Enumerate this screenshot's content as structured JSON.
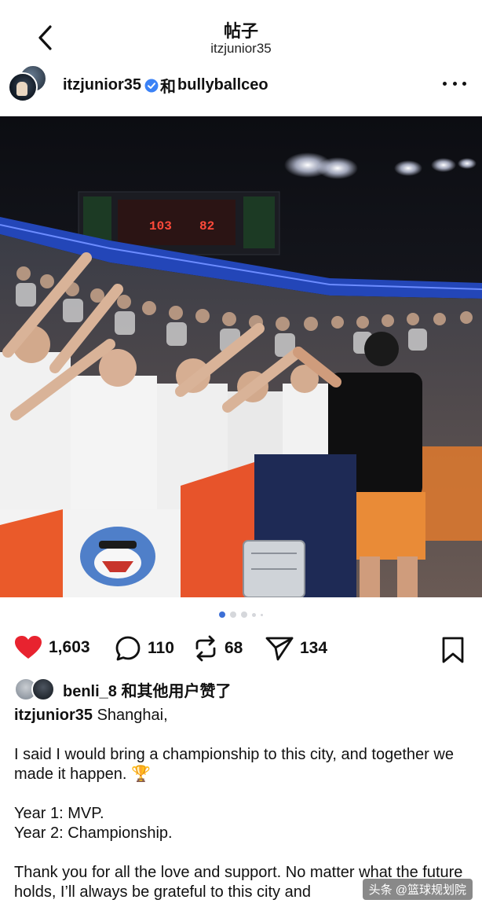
{
  "header": {
    "title": "帖子",
    "subtitle": "itzjunior35"
  },
  "author": {
    "username": "itzjunior35",
    "joiner": "和",
    "collaborator": "bullyballceo"
  },
  "photo": {
    "scoreboard_home": "103",
    "scoreboard_away": "82",
    "pagination": {
      "total": 5,
      "active_index": 0
    }
  },
  "actions": {
    "likes": "1,603",
    "comments": "110",
    "reposts": "68",
    "shares": "134"
  },
  "liked_by": {
    "text": "benli_8 和其他用户赞了"
  },
  "caption": {
    "username": "itzjunior35",
    "first_line": " Shanghai,",
    "paragraph_1": "I said I would bring a championship to this city, and together we made it happen. 🏆",
    "line_year1": "Year 1: MVP.",
    "line_year2": "Year 2: Championship.",
    "paragraph_3": "Thank you for all the love and support. No matter what the future holds, I’ll always be grateful to this city and"
  },
  "watermark": "头条 @篮球规划院",
  "colors": {
    "like_red": "#e8232f",
    "accent_blue": "#3d6fd6",
    "verified_blue": "#3b82f6"
  },
  "icons": {
    "back": "chevron-left-icon",
    "more": "more-dots-icon",
    "like": "heart-icon",
    "comment": "comment-bubble-icon",
    "repost": "repost-icon",
    "share": "paper-plane-icon",
    "bookmark": "bookmark-icon"
  }
}
